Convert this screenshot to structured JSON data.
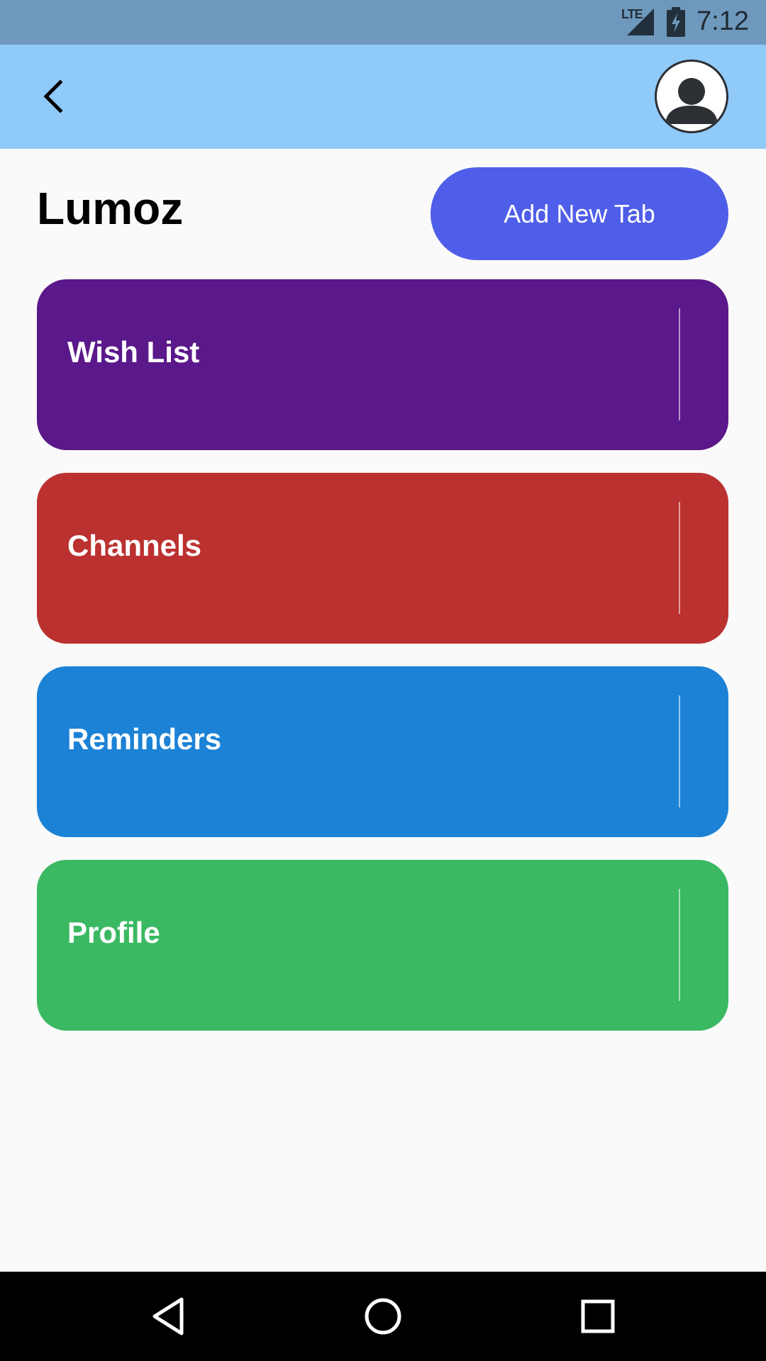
{
  "status_bar": {
    "network_label": "LTE",
    "time": "7:12"
  },
  "app_bar": {
    "back_icon": "chevron-left-icon",
    "avatar_icon": "user-avatar-icon",
    "background_color": "#90caf9"
  },
  "header": {
    "title": "Lumoz",
    "add_button_label": "Add New Tab",
    "add_button_color": "#4f5ee8"
  },
  "tabs": [
    {
      "label": "Wish List",
      "color": "#5b188a"
    },
    {
      "label": "Channels",
      "color": "#bb3130"
    },
    {
      "label": "Reminders",
      "color": "#1c82d6"
    },
    {
      "label": "Profile",
      "color": "#3bb962"
    }
  ],
  "nav_bar": {
    "back_icon": "triangle-back-icon",
    "home_icon": "circle-home-icon",
    "recents_icon": "square-recents-icon"
  }
}
